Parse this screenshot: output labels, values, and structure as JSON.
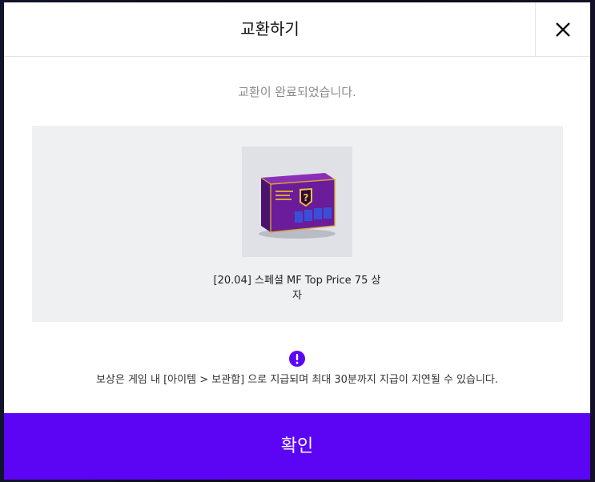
{
  "modal": {
    "title": "교환하기",
    "message": "교환이 완료되었습니다.",
    "item": {
      "name": "[20.04] 스페셜 MF Top Price 75 상자",
      "icon": "mystery-box-icon"
    },
    "notice": "보상은 게임 내 [아이템 > 보관함] 으로 지급되며 최대 30분까지 지급이 지연될 수 있습니다.",
    "confirm_label": "확인"
  },
  "colors": {
    "accent": "#5c05f5",
    "panel_bg": "#eef0f2",
    "text_muted": "#8a8a8a"
  }
}
